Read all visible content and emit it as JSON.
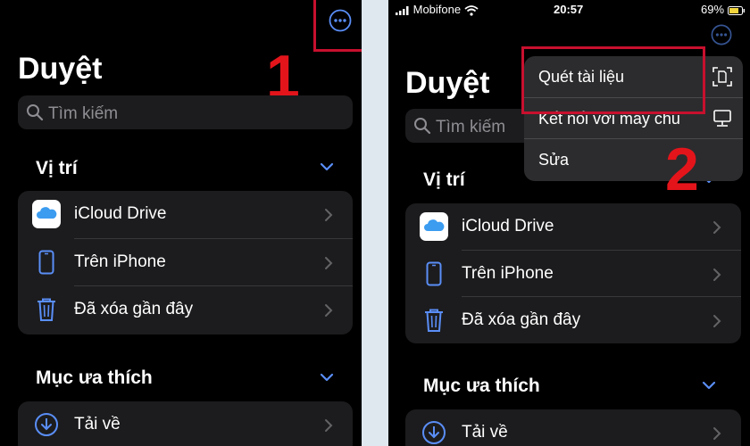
{
  "colors": {
    "accent": "#5a8ef7",
    "annotation": "#e4141b"
  },
  "screen1": {
    "title": "Duyệt",
    "search_placeholder": "Tìm kiếm",
    "locations_header": "Vị trí",
    "locations": [
      {
        "label": "iCloud Drive",
        "icon": "icloud-icon"
      },
      {
        "label": "Trên iPhone",
        "icon": "iphone-icon"
      },
      {
        "label": "Đã xóa gần đây",
        "icon": "trash-icon"
      }
    ],
    "favorites_header": "Mục ưa thích",
    "favorites": [
      {
        "label": "Tải về",
        "icon": "download-icon"
      }
    ],
    "step_number": "1"
  },
  "screen2": {
    "status": {
      "carrier": "Mobifone",
      "time": "20:57",
      "battery": "69%"
    },
    "title": "Duyệt",
    "search_placeholder": "Tìm kiếm",
    "locations_header": "Vị trí",
    "locations": [
      {
        "label": "iCloud Drive",
        "icon": "icloud-icon"
      },
      {
        "label": "Trên iPhone",
        "icon": "iphone-icon"
      },
      {
        "label": "Đã xóa gần đây",
        "icon": "trash-icon"
      }
    ],
    "favorites_header": "Mục ưa thích",
    "favorites": [
      {
        "label": "Tải về",
        "icon": "download-icon"
      }
    ],
    "menu": [
      {
        "label": "Quét tài liệu",
        "icon": "scan-document-icon"
      },
      {
        "label": "Kết nối với máy chủ",
        "icon": "server-icon"
      },
      {
        "label": "Sửa",
        "icon": ""
      }
    ],
    "step_number": "2"
  }
}
